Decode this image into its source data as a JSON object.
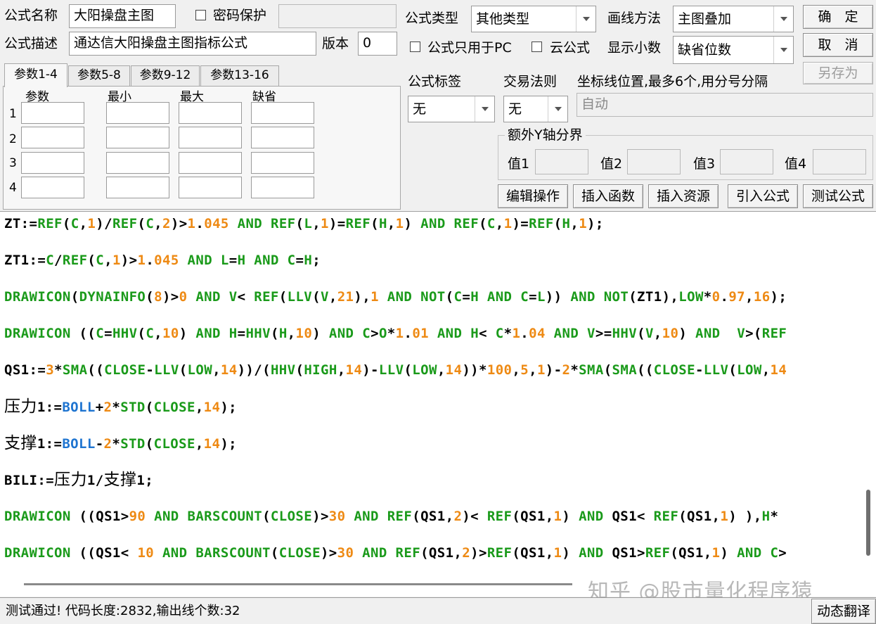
{
  "header": {
    "name_label": "公式名称",
    "name_value": "大阳操盘主图",
    "password_label": "密码保护",
    "password_value": "",
    "desc_label": "公式描述",
    "desc_value": "通达信大阳操盘主图指标公式",
    "version_label": "版本",
    "version_value": "0",
    "type_label": "公式类型",
    "type_value": "其他类型",
    "draw_label": "画线方法",
    "draw_value": "主图叠加",
    "pc_only_label": "公式只用于PC",
    "cloud_label": "云公式",
    "decimals_label": "显示小数",
    "decimals_value": "缺省位数"
  },
  "buttons": {
    "ok": "确　定",
    "cancel": "取　消",
    "save_as": "另存为",
    "edit_ops": "编辑操作",
    "insert_func": "插入函数",
    "insert_res": "插入资源",
    "import_formula": "引入公式",
    "test_formula": "测试公式",
    "dynamic_translate": "动态翻译"
  },
  "tabs": [
    "参数1-4",
    "参数5-8",
    "参数9-12",
    "参数13-16"
  ],
  "params": {
    "columns": [
      "参数",
      "最小",
      "最大",
      "缺省"
    ],
    "rows": [
      "1",
      "2",
      "3",
      "4"
    ]
  },
  "options": {
    "tag_label": "公式标签",
    "tag_value": "无",
    "trade_label": "交易法则",
    "trade_value": "无",
    "coord_label": "坐标线位置,最多6个,用分号分隔",
    "coord_value": "自动",
    "yaxis_group": "额外Y轴分界",
    "y1": "值1",
    "y2": "值2",
    "y3": "值3",
    "y4": "值4"
  },
  "code_lines": [
    [
      [
        "t",
        "ZT:="
      ],
      [
        "k",
        "REF"
      ],
      [
        "t",
        "("
      ],
      [
        "k",
        "C"
      ],
      [
        "t",
        ","
      ],
      [
        "n",
        "1"
      ],
      [
        "t",
        ")/"
      ],
      [
        "k",
        "REF"
      ],
      [
        "t",
        "("
      ],
      [
        "k",
        "C"
      ],
      [
        "t",
        ","
      ],
      [
        "n",
        "2"
      ],
      [
        "t",
        ")>"
      ],
      [
        "n",
        "1"
      ],
      [
        "t",
        "."
      ],
      [
        "n",
        "045"
      ],
      [
        "t",
        " "
      ],
      [
        "k",
        "AND"
      ],
      [
        "t",
        " "
      ],
      [
        "k",
        "REF"
      ],
      [
        "t",
        "("
      ],
      [
        "k",
        "L"
      ],
      [
        "t",
        ","
      ],
      [
        "n",
        "1"
      ],
      [
        "t",
        ")="
      ],
      [
        "k",
        "REF"
      ],
      [
        "t",
        "("
      ],
      [
        "k",
        "H"
      ],
      [
        "t",
        ","
      ],
      [
        "n",
        "1"
      ],
      [
        "t",
        ") "
      ],
      [
        "k",
        "AND"
      ],
      [
        "t",
        " "
      ],
      [
        "k",
        "REF"
      ],
      [
        "t",
        "("
      ],
      [
        "k",
        "C"
      ],
      [
        "t",
        ","
      ],
      [
        "n",
        "1"
      ],
      [
        "t",
        ")="
      ],
      [
        "k",
        "REF"
      ],
      [
        "t",
        "("
      ],
      [
        "k",
        "H"
      ],
      [
        "t",
        ","
      ],
      [
        "n",
        "1"
      ],
      [
        "t",
        ");"
      ]
    ],
    [
      [
        "t",
        "ZT1:="
      ],
      [
        "k",
        "C"
      ],
      [
        "t",
        "/"
      ],
      [
        "k",
        "REF"
      ],
      [
        "t",
        "("
      ],
      [
        "k",
        "C"
      ],
      [
        "t",
        ","
      ],
      [
        "n",
        "1"
      ],
      [
        "t",
        ")>"
      ],
      [
        "n",
        "1"
      ],
      [
        "t",
        "."
      ],
      [
        "n",
        "045"
      ],
      [
        "t",
        " "
      ],
      [
        "k",
        "AND"
      ],
      [
        "t",
        " "
      ],
      [
        "k",
        "L"
      ],
      [
        "t",
        "="
      ],
      [
        "k",
        "H"
      ],
      [
        "t",
        " "
      ],
      [
        "k",
        "AND"
      ],
      [
        "t",
        " "
      ],
      [
        "k",
        "C"
      ],
      [
        "t",
        "="
      ],
      [
        "k",
        "H"
      ],
      [
        "t",
        ";"
      ]
    ],
    [
      [
        "k",
        "DRAWICON"
      ],
      [
        "t",
        "("
      ],
      [
        "k",
        "DYNAINFO"
      ],
      [
        "t",
        "("
      ],
      [
        "n",
        "8"
      ],
      [
        "t",
        ")>"
      ],
      [
        "n",
        "0"
      ],
      [
        "t",
        " "
      ],
      [
        "k",
        "AND"
      ],
      [
        "t",
        " "
      ],
      [
        "k",
        "V"
      ],
      [
        "t",
        "< "
      ],
      [
        "k",
        "REF"
      ],
      [
        "t",
        "("
      ],
      [
        "k",
        "LLV"
      ],
      [
        "t",
        "("
      ],
      [
        "k",
        "V"
      ],
      [
        "t",
        ","
      ],
      [
        "n",
        "21"
      ],
      [
        "t",
        "),"
      ],
      [
        "n",
        "1"
      ],
      [
        "t",
        " "
      ],
      [
        "k",
        "AND"
      ],
      [
        "t",
        " "
      ],
      [
        "k",
        "NOT"
      ],
      [
        "t",
        "("
      ],
      [
        "k",
        "C"
      ],
      [
        "t",
        "="
      ],
      [
        "k",
        "H"
      ],
      [
        "t",
        " "
      ],
      [
        "k",
        "AND"
      ],
      [
        "t",
        " "
      ],
      [
        "k",
        "C"
      ],
      [
        "t",
        "="
      ],
      [
        "k",
        "L"
      ],
      [
        "t",
        ")) "
      ],
      [
        "k",
        "AND"
      ],
      [
        "t",
        " "
      ],
      [
        "k",
        "NOT"
      ],
      [
        "t",
        "(ZT1),"
      ],
      [
        "k",
        "LOW"
      ],
      [
        "t",
        "*"
      ],
      [
        "n",
        "0"
      ],
      [
        "t",
        "."
      ],
      [
        "n",
        "97"
      ],
      [
        "t",
        ","
      ],
      [
        "n",
        "16"
      ],
      [
        "t",
        ");"
      ]
    ],
    [
      [
        "k",
        "DRAWICON"
      ],
      [
        "t",
        " (("
      ],
      [
        "k",
        "C"
      ],
      [
        "t",
        "="
      ],
      [
        "k",
        "HHV"
      ],
      [
        "t",
        "("
      ],
      [
        "k",
        "C"
      ],
      [
        "t",
        ","
      ],
      [
        "n",
        "10"
      ],
      [
        "t",
        ") "
      ],
      [
        "k",
        "AND"
      ],
      [
        "t",
        " "
      ],
      [
        "k",
        "H"
      ],
      [
        "t",
        "="
      ],
      [
        "k",
        "HHV"
      ],
      [
        "t",
        "("
      ],
      [
        "k",
        "H"
      ],
      [
        "t",
        ","
      ],
      [
        "n",
        "10"
      ],
      [
        "t",
        ") "
      ],
      [
        "k",
        "AND"
      ],
      [
        "t",
        " "
      ],
      [
        "k",
        "C"
      ],
      [
        "t",
        ">"
      ],
      [
        "k",
        "O"
      ],
      [
        "t",
        "*"
      ],
      [
        "n",
        "1"
      ],
      [
        "t",
        "."
      ],
      [
        "n",
        "01"
      ],
      [
        "t",
        " "
      ],
      [
        "k",
        "AND"
      ],
      [
        "t",
        " "
      ],
      [
        "k",
        "H"
      ],
      [
        "t",
        "< "
      ],
      [
        "k",
        "C"
      ],
      [
        "t",
        "*"
      ],
      [
        "n",
        "1"
      ],
      [
        "t",
        "."
      ],
      [
        "n",
        "04"
      ],
      [
        "t",
        " "
      ],
      [
        "k",
        "AND"
      ],
      [
        "t",
        " "
      ],
      [
        "k",
        "V"
      ],
      [
        "t",
        ">="
      ],
      [
        "k",
        "HHV"
      ],
      [
        "t",
        "("
      ],
      [
        "k",
        "V"
      ],
      [
        "t",
        ","
      ],
      [
        "n",
        "10"
      ],
      [
        "t",
        ") "
      ],
      [
        "k",
        "AND"
      ],
      [
        "t",
        "  "
      ],
      [
        "k",
        "V"
      ],
      [
        "t",
        ">("
      ],
      [
        "k",
        "REF"
      ]
    ],
    [
      [
        "t",
        "QS1:="
      ],
      [
        "n",
        "3"
      ],
      [
        "t",
        "*"
      ],
      [
        "k",
        "SMA"
      ],
      [
        "t",
        "(("
      ],
      [
        "k",
        "CLOSE"
      ],
      [
        "t",
        "-"
      ],
      [
        "k",
        "LLV"
      ],
      [
        "t",
        "("
      ],
      [
        "k",
        "LOW"
      ],
      [
        "t",
        ","
      ],
      [
        "n",
        "14"
      ],
      [
        "t",
        "))/("
      ],
      [
        "k",
        "HHV"
      ],
      [
        "t",
        "("
      ],
      [
        "k",
        "HIGH"
      ],
      [
        "t",
        ","
      ],
      [
        "n",
        "14"
      ],
      [
        "t",
        ")-"
      ],
      [
        "k",
        "LLV"
      ],
      [
        "t",
        "("
      ],
      [
        "k",
        "LOW"
      ],
      [
        "t",
        ","
      ],
      [
        "n",
        "14"
      ],
      [
        "t",
        "))*"
      ],
      [
        "n",
        "100"
      ],
      [
        "t",
        ","
      ],
      [
        "n",
        "5"
      ],
      [
        "t",
        ","
      ],
      [
        "n",
        "1"
      ],
      [
        "t",
        ")-"
      ],
      [
        "n",
        "2"
      ],
      [
        "t",
        "*"
      ],
      [
        "k",
        "SMA"
      ],
      [
        "t",
        "("
      ],
      [
        "k",
        "SMA"
      ],
      [
        "t",
        "(("
      ],
      [
        "k",
        "CLOSE"
      ],
      [
        "t",
        "-"
      ],
      [
        "k",
        "LLV"
      ],
      [
        "t",
        "("
      ],
      [
        "k",
        "LOW"
      ],
      [
        "t",
        ","
      ],
      [
        "n",
        "14"
      ]
    ],
    [
      [
        "z",
        "压力"
      ],
      [
        "t",
        "1:="
      ],
      [
        "b",
        "BOLL"
      ],
      [
        "t",
        "+"
      ],
      [
        "n",
        "2"
      ],
      [
        "t",
        "*"
      ],
      [
        "k",
        "STD"
      ],
      [
        "t",
        "("
      ],
      [
        "k",
        "CLOSE"
      ],
      [
        "t",
        ","
      ],
      [
        "n",
        "14"
      ],
      [
        "t",
        ");"
      ]
    ],
    [
      [
        "z",
        "支撑"
      ],
      [
        "t",
        "1:="
      ],
      [
        "b",
        "BOLL"
      ],
      [
        "t",
        "-"
      ],
      [
        "n",
        "2"
      ],
      [
        "t",
        "*"
      ],
      [
        "k",
        "STD"
      ],
      [
        "t",
        "("
      ],
      [
        "k",
        "CLOSE"
      ],
      [
        "t",
        ","
      ],
      [
        "n",
        "14"
      ],
      [
        "t",
        ");"
      ]
    ],
    [
      [
        "t",
        "BILI:="
      ],
      [
        "z",
        "压力"
      ],
      [
        "t",
        "1/"
      ],
      [
        "z",
        "支撑"
      ],
      [
        "t",
        "1;"
      ]
    ],
    [
      [
        "k",
        "DRAWICON"
      ],
      [
        "t",
        " ((QS1>"
      ],
      [
        "n",
        "90"
      ],
      [
        "t",
        " "
      ],
      [
        "k",
        "AND"
      ],
      [
        "t",
        " "
      ],
      [
        "k",
        "BARSCOUNT"
      ],
      [
        "t",
        "("
      ],
      [
        "k",
        "CLOSE"
      ],
      [
        "t",
        ")>"
      ],
      [
        "n",
        "30"
      ],
      [
        "t",
        " "
      ],
      [
        "k",
        "AND"
      ],
      [
        "t",
        " "
      ],
      [
        "k",
        "REF"
      ],
      [
        "t",
        "(QS1,"
      ],
      [
        "n",
        "2"
      ],
      [
        "t",
        ")< "
      ],
      [
        "k",
        "REF"
      ],
      [
        "t",
        "(QS1,"
      ],
      [
        "n",
        "1"
      ],
      [
        "t",
        ") "
      ],
      [
        "k",
        "AND"
      ],
      [
        "t",
        " QS1< "
      ],
      [
        "k",
        "REF"
      ],
      [
        "t",
        "(QS1,"
      ],
      [
        "n",
        "1"
      ],
      [
        "t",
        ") ),"
      ],
      [
        "k",
        "H"
      ],
      [
        "t",
        "*"
      ]
    ],
    [
      [
        "k",
        "DRAWICON"
      ],
      [
        "t",
        " ((QS1< "
      ],
      [
        "n",
        "10"
      ],
      [
        "t",
        " "
      ],
      [
        "k",
        "AND"
      ],
      [
        "t",
        " "
      ],
      [
        "k",
        "BARSCOUNT"
      ],
      [
        "t",
        "("
      ],
      [
        "k",
        "CLOSE"
      ],
      [
        "t",
        ")>"
      ],
      [
        "n",
        "30"
      ],
      [
        "t",
        " "
      ],
      [
        "k",
        "AND"
      ],
      [
        "t",
        " "
      ],
      [
        "k",
        "REF"
      ],
      [
        "t",
        "(QS1,"
      ],
      [
        "n",
        "2"
      ],
      [
        "t",
        ")>"
      ],
      [
        "k",
        "REF"
      ],
      [
        "t",
        "(QS1,"
      ],
      [
        "n",
        "1"
      ],
      [
        "t",
        ") "
      ],
      [
        "k",
        "AND"
      ],
      [
        "t",
        " QS1>"
      ],
      [
        "k",
        "REF"
      ],
      [
        "t",
        "(QS1,"
      ],
      [
        "n",
        "1"
      ],
      [
        "t",
        ") "
      ],
      [
        "k",
        "AND"
      ],
      [
        "t",
        " "
      ],
      [
        "k",
        "C"
      ],
      [
        "t",
        ">"
      ]
    ]
  ],
  "watermark": "知乎 @股市量化程序猿",
  "status": "测试通过! 代码长度:2832,输出线个数:32"
}
